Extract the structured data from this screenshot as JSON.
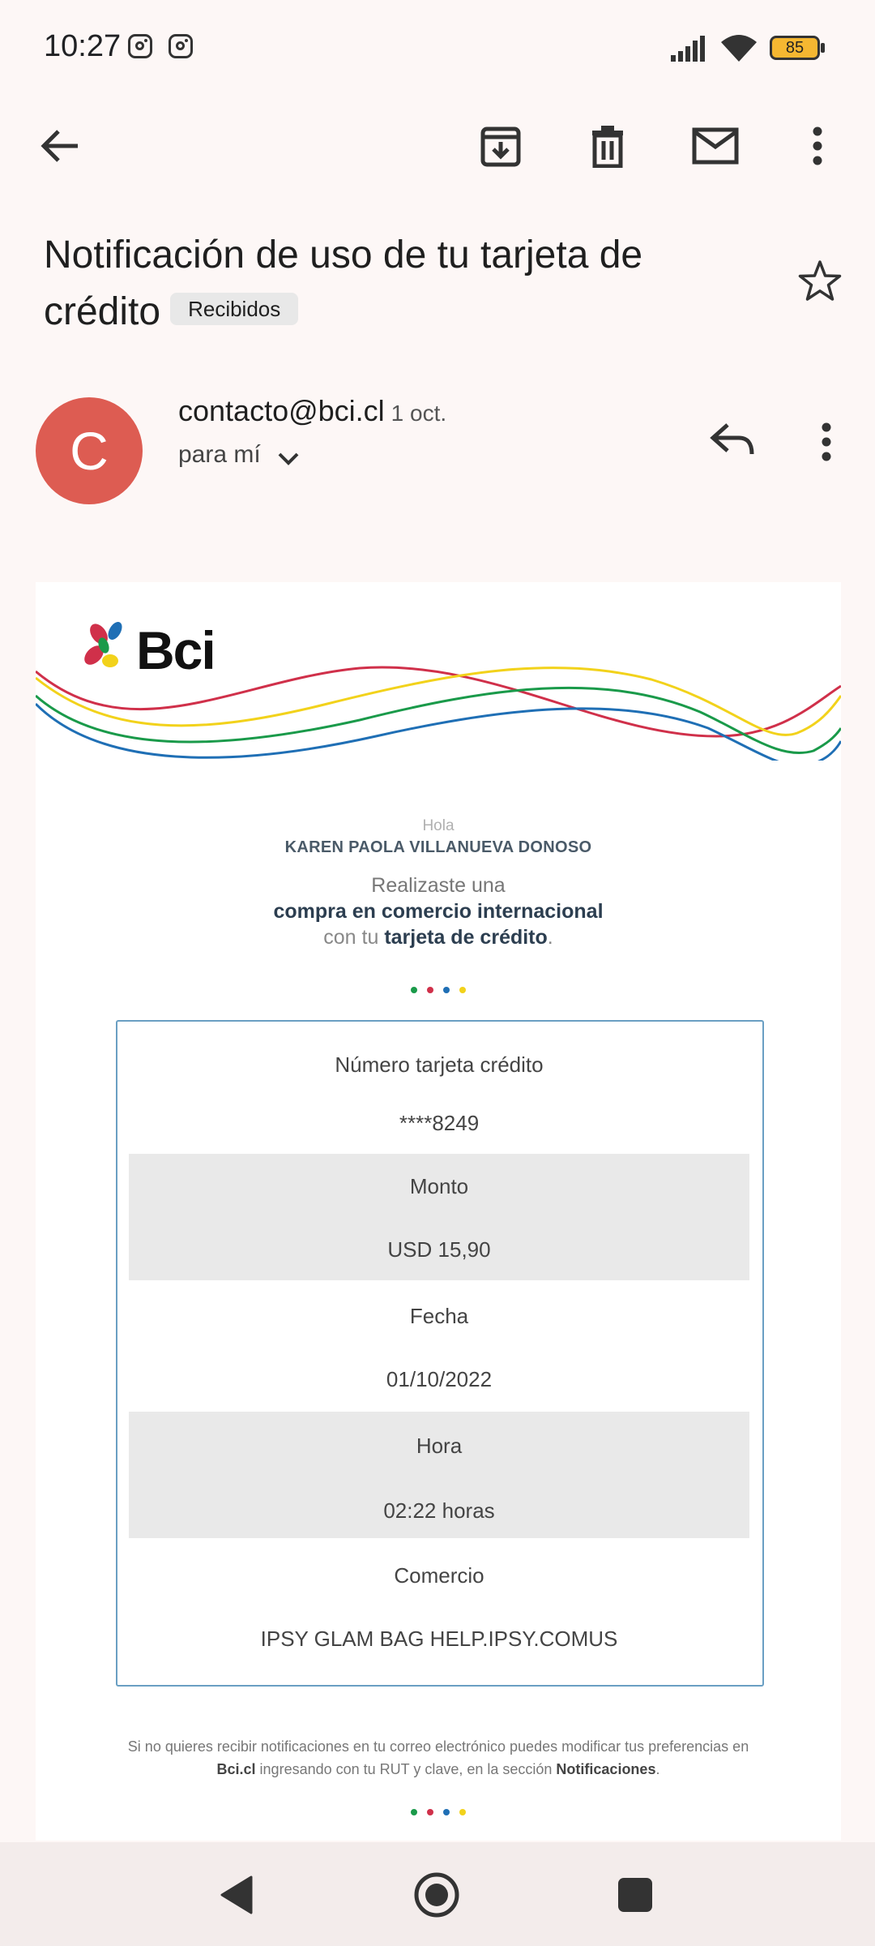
{
  "status_bar": {
    "time": "10:27",
    "battery": "85",
    "notification_icons": [
      "instagram-icon",
      "instagram-icon"
    ]
  },
  "toolbar": {
    "icons": [
      "back-arrow-icon",
      "archive-icon",
      "delete-icon",
      "mark-unread-icon",
      "more-vert-icon"
    ]
  },
  "email": {
    "subject": "Notificación de uso de tu tarjeta de crédito",
    "label": "Recibidos",
    "sender_initial": "C",
    "sender": "contacto@bci.cl",
    "date": "1 oct.",
    "recipient": "para mí"
  },
  "message": {
    "logo_text": "Bci",
    "greeting": "Hola",
    "name": "KAREN PAOLA VILLANUEVA DONOSO",
    "line1": "Realizaste una",
    "line2": "compra en comercio internacional",
    "line3_prefix": "con tu ",
    "line3_bold": "tarjeta de crédito",
    "line3_suffix": ".",
    "details": [
      {
        "label": "Número tarjeta crédito",
        "value": "****8249"
      },
      {
        "label": "Monto",
        "value": "USD 15,90"
      },
      {
        "label": "Fecha",
        "value": "01/10/2022"
      },
      {
        "label": "Hora",
        "value": "02:22 horas"
      },
      {
        "label": "Comercio",
        "value": "IPSY GLAM BAG HELP.IPSY.COMUS"
      }
    ],
    "footer_part1": "Si no quieres recibir notificaciones en tu correo electrónico puedes modificar tus preferencias en",
    "footer_link": "Bci.cl",
    "footer_part2": " ingresando con tu RUT y clave, en la sección ",
    "footer_section": "Notificaciones",
    "footer_end": "."
  },
  "colors": {
    "green": "#1a9a4a",
    "red": "#d0304a",
    "blue": "#1f6fb5",
    "yellow": "#f2d21b",
    "avatar": "#dd5c52"
  }
}
